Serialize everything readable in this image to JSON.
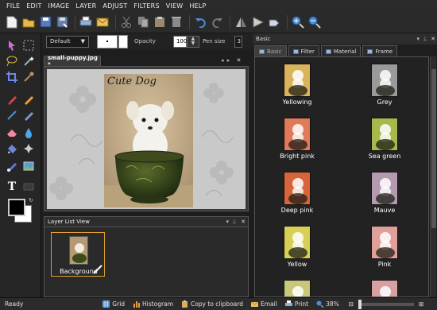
{
  "menu": [
    "FILE",
    "EDIT",
    "IMAGE",
    "LAYER",
    "ADJUST",
    "FILTERS",
    "VIEW",
    "HELP"
  ],
  "toolbar_icons": [
    "new-file",
    "open-folder",
    "save",
    "save-as",
    "print",
    "email",
    "cut",
    "copy",
    "paste",
    "delete",
    "undo",
    "redo",
    "flip",
    "rotate",
    "rotate-cw",
    "zoom-in",
    "zoom-out"
  ],
  "options": {
    "blend_mode": "Default",
    "opacity_label": "Opacity",
    "opacity_value": "100",
    "pen_size_label": "Pen size",
    "pen_size_value": "3"
  },
  "document": {
    "tab_title": "small-puppy.jpg *",
    "handwritten_text": "Cute Dog"
  },
  "layers": {
    "panel_title": "Layer List View",
    "items": [
      {
        "name": "Background"
      }
    ]
  },
  "effects_panel": {
    "title": "Basic",
    "tabs": [
      "Basic",
      "Filter",
      "Material",
      "Frame"
    ],
    "active_tab": "Basic",
    "items": [
      {
        "label": "Yellowing",
        "tint": "#d9b45a"
      },
      {
        "label": "Grey",
        "tint": "#9a9a9a"
      },
      {
        "label": "Bright pink",
        "tint": "#e07a5a"
      },
      {
        "label": "Sea green",
        "tint": "#a8b84a"
      },
      {
        "label": "Deep pink",
        "tint": "#d8643c"
      },
      {
        "label": "Mauve",
        "tint": "#b49ab0"
      },
      {
        "label": "Yellow",
        "tint": "#d8cf55"
      },
      {
        "label": "Pink",
        "tint": "#e0a09a"
      },
      {
        "label": "",
        "tint": "#c8c87a"
      },
      {
        "label": "",
        "tint": "#d8a0a0"
      }
    ]
  },
  "status": {
    "ready": "Ready",
    "grid": "Grid",
    "histogram": "Histogram",
    "copy": "Copy to clipboard",
    "email": "Email",
    "print": "Print",
    "zoom": "38%"
  },
  "colors": {
    "accent_blue": "#4a8fd8",
    "foreground_swatch": "#000000",
    "background_swatch": "#ffffff",
    "panel_bg": "#2a2a2a"
  }
}
